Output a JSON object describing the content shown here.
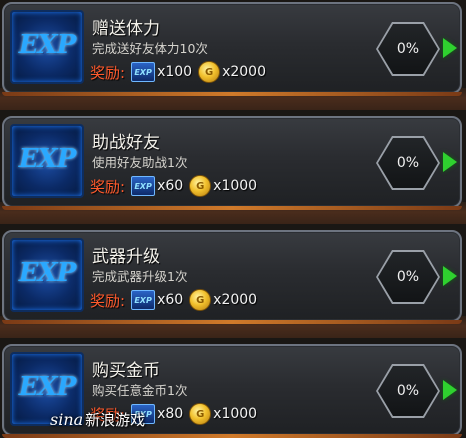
{
  "reward_label": "奖励:",
  "watermark": {
    "logo_text": "sina",
    "text": "新浪游戏"
  },
  "badge_text": "EXP",
  "quests": [
    {
      "title": "赠送体力",
      "description": "完成送好友体力10次",
      "exp_amount": "x100",
      "gold_amount": "x2000",
      "progress": "0%",
      "progress_value": 0
    },
    {
      "title": "助战好友",
      "description": "使用好友助战1次",
      "exp_amount": "x60",
      "gold_amount": "x1000",
      "progress": "0%",
      "progress_value": 0
    },
    {
      "title": "武器升级",
      "description": "完成武器升级1次",
      "exp_amount": "x60",
      "gold_amount": "x2000",
      "progress": "0%",
      "progress_value": 0
    },
    {
      "title": "购买金币",
      "description": "购买任意金币1次",
      "exp_amount": "x80",
      "gold_amount": "x1000",
      "progress": "0%",
      "progress_value": 0
    }
  ],
  "colors": {
    "accent_green": "#2fd12f",
    "reward_red": "#ff5a2c",
    "exp_blue": "#2aa8ff",
    "gold": "#f2c12d"
  },
  "icons": {
    "exp_badge": "exp-badge-icon",
    "exp_reward": "exp-reward-icon",
    "gold_coin": "gold-coin-icon",
    "go_arrow": "play-arrow-icon"
  }
}
